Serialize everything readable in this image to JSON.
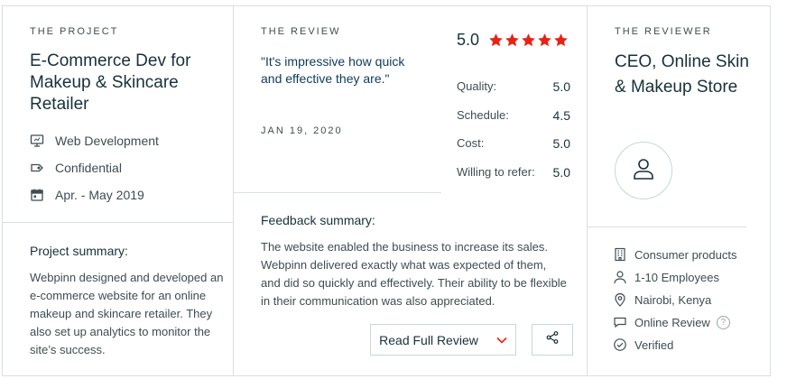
{
  "project": {
    "eyebrow": "THE PROJECT",
    "title": "E-Commerce Dev for Makeup & Skincare Retailer",
    "meta": [
      {
        "icon": "monitor-icon",
        "label": "Web Development"
      },
      {
        "icon": "tag-icon",
        "label": "Confidential"
      },
      {
        "icon": "calendar-icon",
        "label": "Apr. - May 2019"
      }
    ],
    "summary_heading": "Project summary:",
    "summary": "Webpinn designed and developed an e-commerce website for an online makeup and skincare retailer. They also set up analytics to monitor the site’s success."
  },
  "review": {
    "eyebrow": "THE REVIEW",
    "quote": "\"It's impressive how quick and effective they are.\"",
    "date": "JAN 19, 2020",
    "overall": "5.0",
    "stars": 5,
    "star_color": "#e62415",
    "ratings": [
      {
        "label": "Quality:",
        "value": "5.0"
      },
      {
        "label": "Schedule:",
        "value": "4.5"
      },
      {
        "label": "Cost:",
        "value": "5.0"
      },
      {
        "label": "Willing to refer:",
        "value": "5.0"
      }
    ],
    "feedback_heading": "Feedback summary:",
    "feedback": "The website enabled the business to increase its sales. Webpinn delivered exactly what was expected of them, and did so quickly and effectively. Their ability to be flexible in their communication was also appreciated.",
    "read_full_label": "Read Full Review",
    "accent_color": "#e62415"
  },
  "reviewer": {
    "eyebrow": "THE REVIEWER",
    "title": "CEO, Online Skin & Makeup Store",
    "avatar_icon": "user-icon",
    "attributes": [
      {
        "icon": "building-icon",
        "label": "Consumer products"
      },
      {
        "icon": "person-icon",
        "label": "1-10 Employees"
      },
      {
        "icon": "location-pin-icon",
        "label": "Nairobi, Kenya"
      },
      {
        "icon": "chat-bubble-icon",
        "label": "Online Review",
        "help": "?"
      },
      {
        "icon": "check-circle-icon",
        "label": "Verified"
      }
    ]
  }
}
